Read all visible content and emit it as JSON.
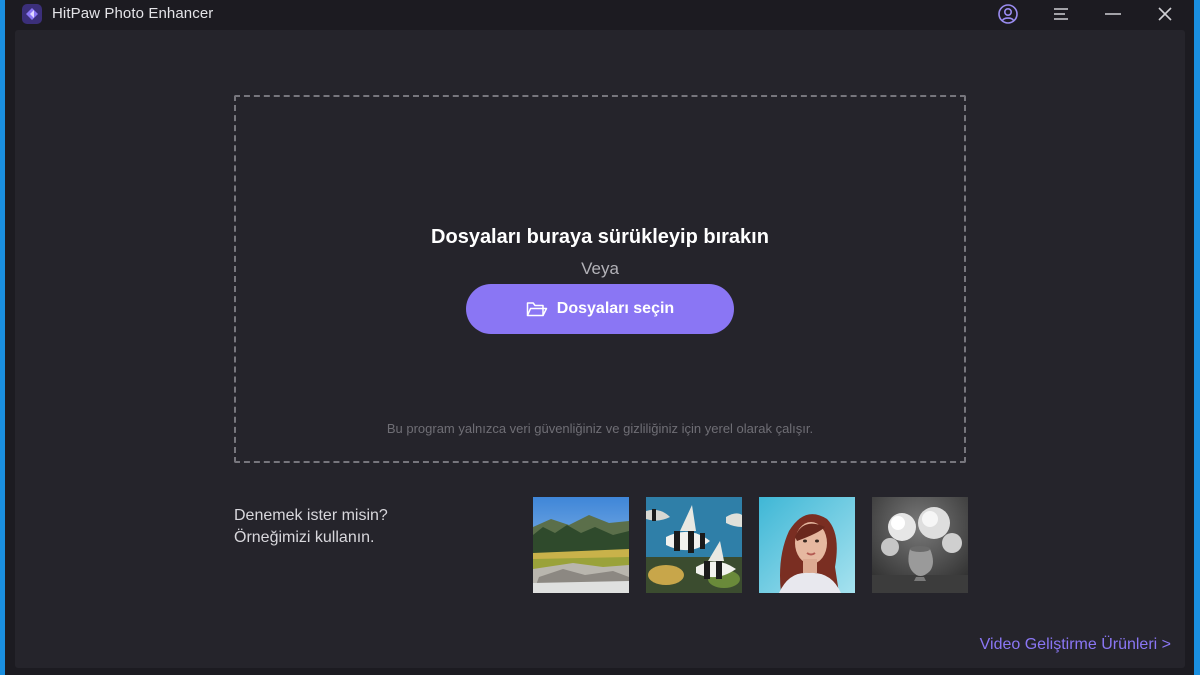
{
  "app": {
    "title": "HitPaw Photo Enhancer"
  },
  "titlebar": {
    "icons": [
      "account-icon",
      "menu-icon",
      "minimize-icon",
      "close-icon"
    ]
  },
  "dropzone": {
    "heading": "Dosyaları buraya sürükleyip bırakın",
    "or": "Veya",
    "select_label": "Dosyaları seçin",
    "privacy_note": "Bu program yalnızca veri güvenliğiniz ve gizliliğiniz için yerel olarak çalışır."
  },
  "samples": {
    "prompt_line1": "Denemek ister misin?",
    "prompt_line2": "Örneğimizi kullanın.",
    "items": [
      "landscape-sample",
      "fish-sample",
      "portrait-sample",
      "flowers-sample"
    ]
  },
  "footer": {
    "video_link": "Video Geliştirme Ürünleri >"
  },
  "colors": {
    "accent": "#8a76f4",
    "window_bg": "#1c1b21",
    "content_bg": "#25242b",
    "desktop": "#1a8fe0"
  }
}
